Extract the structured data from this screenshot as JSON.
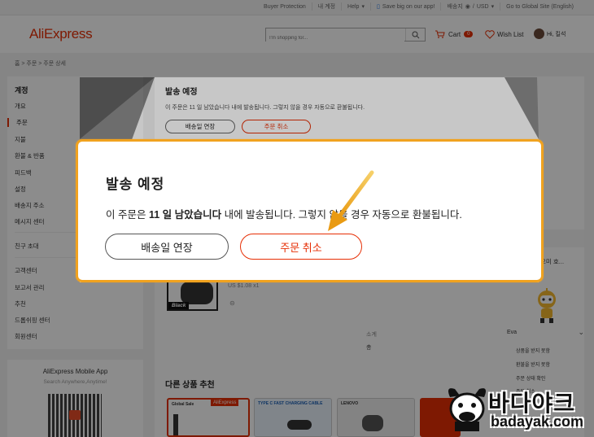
{
  "topbar": {
    "links": [
      "Buyer Protection",
      "내 계정",
      "Help",
      "Save big on our app!",
      "배송지",
      "USD",
      "Go to Global Site (English)"
    ]
  },
  "header": {
    "logo": "AliExpress",
    "search_placeholder": "I'm shopping for...",
    "cart_label": "Cart",
    "cart_count": "0",
    "wishlist_label": "Wish List",
    "user_greeting": "Hi, 킬석"
  },
  "breadcrumb": "홈  >  주문  >  주문 상세",
  "sidebar": {
    "title": "계정",
    "items": [
      "개요",
      "주문",
      "지불",
      "환불 & 반품",
      "피드백",
      "설정",
      "배송지 주소",
      "메시지 센터",
      "친구 초대",
      "고객센터",
      "보고서 관리",
      "추천",
      "드롭쉬핑 센터",
      "회원센터"
    ]
  },
  "mobile_app": {
    "title": "AliExpress Mobile App",
    "subtitle": "Search Anywhere,Anytime!"
  },
  "order_bg": {
    "title": "발송 예정",
    "desc": "이 주문은 11 일 남았습니다 내에 발송됩니다. 그렇지 않을 경우 자동으로 환불됩니다.",
    "extend_label": "배송일 연장",
    "cancel_label": "주문 취소",
    "product_name": "오미 호...",
    "product_label": "Black",
    "product_price": "US $1.08  x1",
    "summary_label": "소계",
    "total_label": "총",
    "recommend_title": "다른 상품 추천",
    "rec_tags": [
      "Global Sale",
      "AliExpress",
      "TYPE C FAST CHARGING CABLE",
      "LENOVO"
    ]
  },
  "dropdown": {
    "name": "Eva",
    "items": [
      "상품을 받지 못함",
      "환불을 받지 못함",
      "주문 상태 확인",
      "주문 취소"
    ]
  },
  "popup": {
    "title": "발송 예정",
    "desc_prefix": "이 주문은 ",
    "desc_bold": "11 일 남았습니다",
    "desc_suffix": " 내에 발송됩니다. 그렇지 않을 경우 자동으로 환불됩니다.",
    "extend_label": "배송일 연장",
    "cancel_label": "주문 취소"
  },
  "watermark": {
    "korean": "바다야크",
    "latin": "badayak.com"
  },
  "colors": {
    "brand": "#e62e04",
    "highlight": "#f0a21f"
  }
}
